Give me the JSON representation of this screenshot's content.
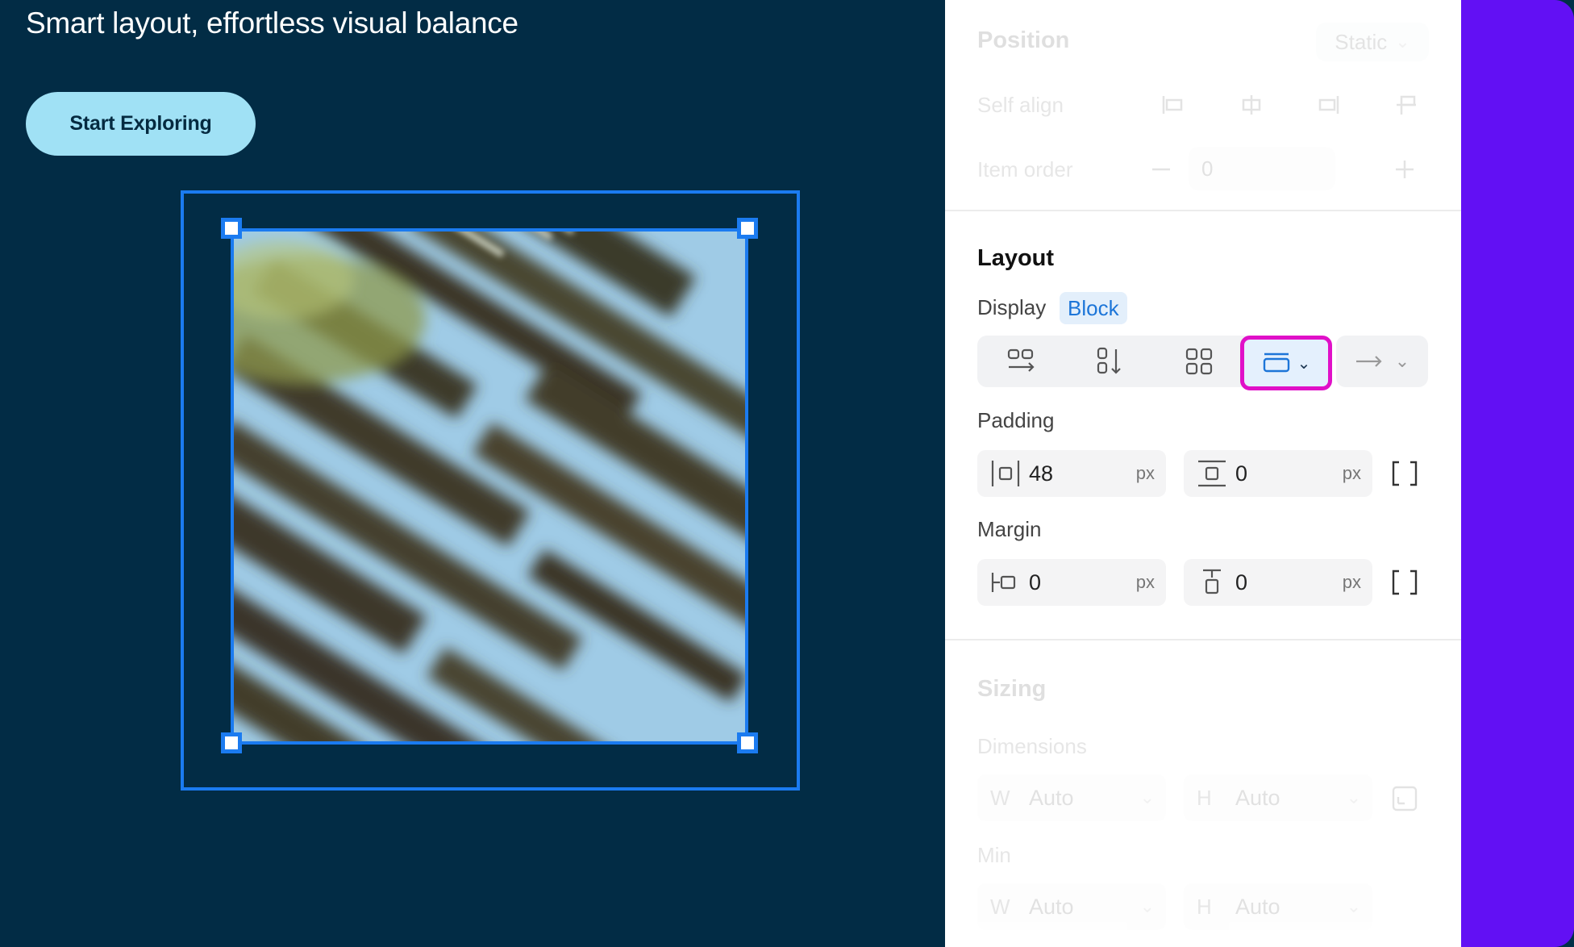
{
  "canvas": {
    "headline": "Smart layout, effortless visual balance",
    "cta_label": "Start Exploring"
  },
  "inspector": {
    "position": {
      "title": "Position",
      "value": "Static",
      "self_align_label": "Self align",
      "item_order_label": "Item order",
      "item_order_value": "0"
    },
    "layout": {
      "title": "Layout",
      "display_label": "Display",
      "display_value": "Block",
      "display_modes": [
        "row-wrap-icon",
        "column-icon",
        "grid-icon",
        "block-icon"
      ],
      "active_mode": "block-icon",
      "padding_label": "Padding",
      "padding_horizontal": "48",
      "padding_vertical": "0",
      "margin_label": "Margin",
      "margin_horizontal": "0",
      "margin_vertical": "0",
      "unit": "px"
    },
    "sizing": {
      "title": "Sizing",
      "dimensions_label": "Dimensions",
      "min_label": "Min",
      "w_prefix": "W",
      "h_prefix": "H",
      "width_value": "Auto",
      "height_value": "Auto",
      "min_width_value": "Auto",
      "min_height_value": "Auto"
    }
  },
  "colors": {
    "canvas_bg": "#022c45",
    "selection": "#1b7bf0",
    "cta_bg": "#a0e1f5",
    "highlight": "#e010c8",
    "accent_strip": "#6210f4",
    "badge_text": "#1c75d8"
  }
}
